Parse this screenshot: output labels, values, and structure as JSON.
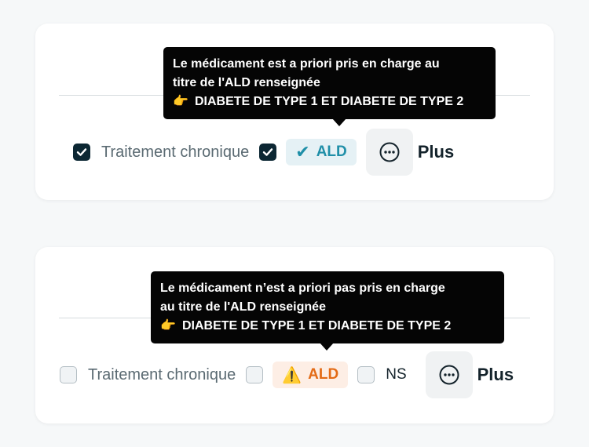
{
  "colors": {
    "checkbox_checked": "#0c2733",
    "ald_ok_text": "#1f8fa8",
    "ald_ok_bg": "#e5f1f5",
    "ald_warn_text": "#e36b16",
    "ald_warn_bg": "#fdeee5",
    "tooltip_bg": "#050505"
  },
  "card1": {
    "tooltip": {
      "line1": "Le médicament est a priori pris en charge au",
      "line2": "titre de l'ALD renseignée",
      "pointer_icon": "👉",
      "condition": "DIABETE DE TYPE 1 ET DIABETE DE TYPE 2"
    },
    "chronic_checkbox": {
      "checked": true,
      "label": "Traitement chronique"
    },
    "ald_checkbox": {
      "checked": true
    },
    "ald_badge": {
      "icon": "✔",
      "label": "ALD",
      "status": "check-icon"
    },
    "more": {
      "icon": "ellipsis-circle-icon",
      "label": "Plus"
    }
  },
  "card2": {
    "tooltip": {
      "line1": "Le médicament n’est a priori pas pris en charge",
      "line2": "au titre de l'ALD renseignée",
      "pointer_icon": "👉",
      "condition": "DIABETE DE TYPE 1 ET DIABETE DE TYPE 2"
    },
    "chronic_checkbox": {
      "checked": false,
      "label": "Traitement chronique"
    },
    "ald_checkbox": {
      "checked": false
    },
    "ald_badge": {
      "icon": "⚠️",
      "label": "ALD",
      "status": "warning-icon"
    },
    "ns_checkbox": {
      "checked": false,
      "label": "NS"
    },
    "more": {
      "icon": "ellipsis-circle-icon",
      "label": "Plus"
    }
  }
}
